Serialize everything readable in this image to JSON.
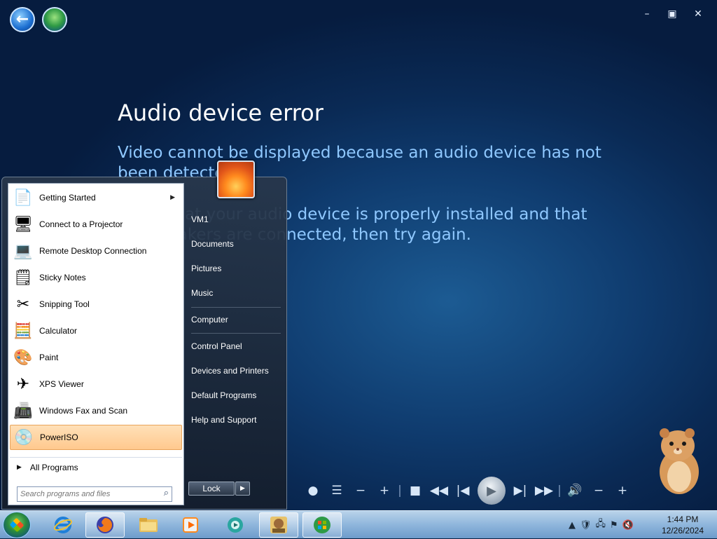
{
  "window": {
    "controls": {
      "minimize": "–",
      "restore": "▣",
      "close": "✕"
    }
  },
  "error": {
    "title": "Audio device error",
    "line1": "Video cannot be displayed because an audio device has not",
    "line2": "been detected.",
    "line3": "Verify that your audio device is properly installed and that",
    "line4": "the speakers are connected, then try again."
  },
  "start_menu": {
    "programs": [
      {
        "label": "Getting Started",
        "icon": "getting-started-icon",
        "has_submenu": true
      },
      {
        "label": "Connect to a Projector",
        "icon": "projector-icon"
      },
      {
        "label": "Remote Desktop Connection",
        "icon": "remote-desktop-icon"
      },
      {
        "label": "Sticky Notes",
        "icon": "sticky-notes-icon"
      },
      {
        "label": "Snipping Tool",
        "icon": "snipping-tool-icon"
      },
      {
        "label": "Calculator",
        "icon": "calculator-icon"
      },
      {
        "label": "Paint",
        "icon": "paint-icon"
      },
      {
        "label": "XPS Viewer",
        "icon": "xps-viewer-icon"
      },
      {
        "label": "Windows Fax and Scan",
        "icon": "fax-scan-icon"
      },
      {
        "label": "PowerISO",
        "icon": "poweriso-icon",
        "highlighted": true
      }
    ],
    "all_programs": "All Programs",
    "search_placeholder": "Search programs and files",
    "right_items": [
      "VM1",
      "Documents",
      "Pictures",
      "Music",
      "Computer",
      "Control Panel",
      "Devices and Printers",
      "Default Programs",
      "Help and Support"
    ],
    "lock_label": "Lock"
  },
  "taskbar": {
    "apps": [
      "internet-explorer-icon",
      "firefox-icon",
      "file-explorer-icon",
      "media-center-icon",
      "app-icon",
      "sandboxie-icon",
      "windows-media-center-icon"
    ],
    "time": "1:44 PM",
    "date": "12/26/2024"
  },
  "colors": {
    "accent": "#ffc98e",
    "error_text": "#8fc8ff"
  }
}
